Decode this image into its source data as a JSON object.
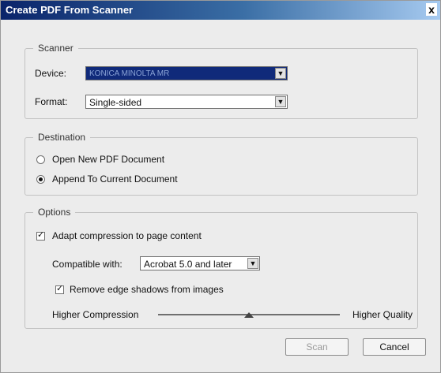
{
  "window": {
    "title": "Create PDF From Scanner",
    "close_label": "x"
  },
  "scanner": {
    "group_label": "Scanner",
    "device_label": "Device:",
    "device_value": "KONICA MINOLTA MR",
    "format_label": "Format:",
    "format_value": "Single-sided"
  },
  "destination": {
    "group_label": "Destination",
    "options": [
      {
        "label": "Open New PDF Document",
        "selected": false
      },
      {
        "label": "Append To Current Document",
        "selected": true
      }
    ]
  },
  "options": {
    "group_label": "Options",
    "adapt_compression": {
      "label": "Adapt compression to page content",
      "checked": true
    },
    "compatible_label": "Compatible with:",
    "compatible_value": "Acrobat 5.0 and later",
    "remove_shadows": {
      "label": "Remove edge shadows from images",
      "checked": true
    },
    "slider": {
      "left_label": "Higher Compression",
      "right_label": "Higher Quality",
      "value_fraction": 0.5
    }
  },
  "buttons": {
    "scan": "Scan",
    "cancel": "Cancel"
  },
  "glyphs": {
    "dropdown": "▼",
    "check": "✓"
  }
}
